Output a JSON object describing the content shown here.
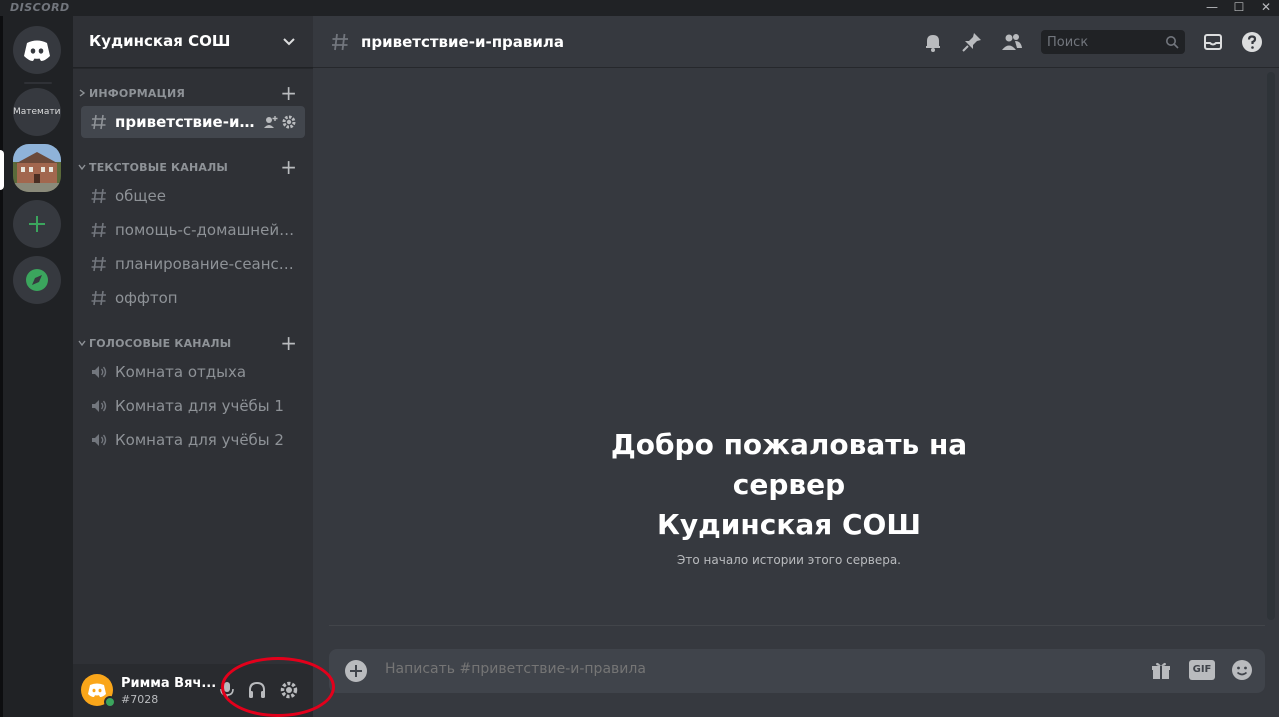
{
  "app": {
    "brand": "DISCORD"
  },
  "window": {
    "minimize": "—",
    "maximize": "☐",
    "close": "✕"
  },
  "rail": {
    "text_server": "Математика"
  },
  "guild": {
    "name": "Кудинская СОШ"
  },
  "categories": [
    {
      "label": "ИНФОРМАЦИЯ"
    },
    {
      "label": "ТЕКСТОВЫЕ КАНАЛЫ"
    },
    {
      "label": "ГОЛОСОВЫЕ КАНАЛЫ"
    }
  ],
  "channels": {
    "info": [
      {
        "name": "приветствие-и-правила",
        "active": true
      }
    ],
    "text": [
      {
        "name": "общее"
      },
      {
        "name": "помощь-с-домашней-работой"
      },
      {
        "name": "планирование-сеансов"
      },
      {
        "name": "оффтоп"
      }
    ],
    "voice": [
      {
        "name": "Комната отдыха"
      },
      {
        "name": "Комната для учёбы 1"
      },
      {
        "name": "Комната для учёбы 2"
      }
    ]
  },
  "user": {
    "name": "Римма Вяч...",
    "tag": "#7028"
  },
  "header": {
    "channel": "приветствие-и-правила",
    "search_placeholder": "Поиск"
  },
  "welcome": {
    "line1": "Добро пожаловать на",
    "line2": "сервер",
    "line3": "Кудинская СОШ",
    "subtitle": "Это начало истории этого сервера."
  },
  "composer": {
    "placeholder": "Написать #приветствие-и-правила",
    "gif_label": "GIF"
  },
  "colors": {
    "background": "#36393f",
    "sidebar": "#2f3136",
    "rail": "#202225",
    "accent_green": "#3ba55d",
    "annotation": "#e3001b"
  }
}
